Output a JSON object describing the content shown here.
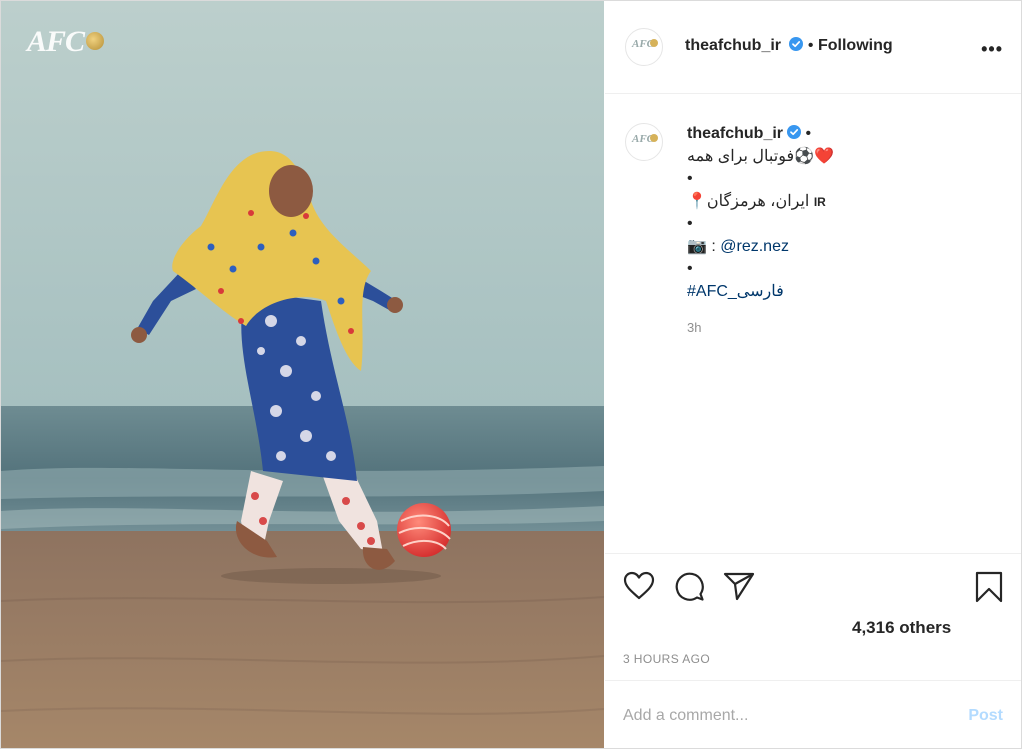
{
  "photo": {
    "logo_text": "AFC",
    "colors": {
      "sky": "#a9c3c2",
      "sea": "#5f7f86",
      "sand": "#9c7d63",
      "scarf": "#e7c451",
      "dress": "#2c4f9a",
      "ball": "#e8413c"
    }
  },
  "header": {
    "username": "theafchub_ir",
    "separator": "•",
    "follow_label": "Following",
    "more_label": "•••"
  },
  "caption": {
    "username": "theafchub_ir",
    "trailing_dot": "•",
    "line1_text": "فوتبال برای همه",
    "line1_emoji": "⚽❤️",
    "bullet": "•",
    "location_flag": "IR",
    "location_text": "ایران، هرمزگان",
    "location_emoji": "📍",
    "photo_credit_emoji": "📷",
    "photo_credit_sep": " : ",
    "photo_credit_handle": "@rez.nez",
    "hashtag": "#AFC_فارسی",
    "time": "3h"
  },
  "actions": {
    "likes_text": "4,316 others",
    "timestamp": "3 HOURS AGO"
  },
  "comment": {
    "placeholder": "Add a comment...",
    "post_label": "Post"
  },
  "theme": {
    "link": "#00376b",
    "verified": "#3897f0",
    "muted": "#8e8e8e",
    "post_disabled": "#b3dbff"
  }
}
